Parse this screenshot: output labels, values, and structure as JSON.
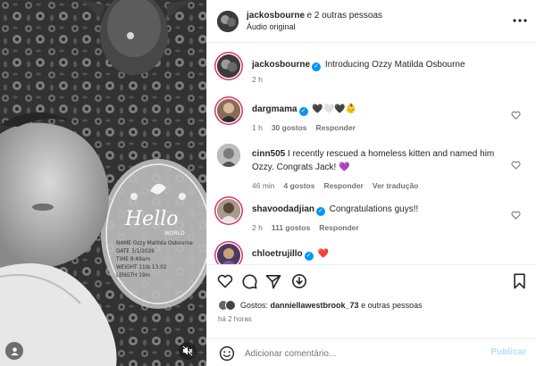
{
  "header": {
    "username": "jackosbourne",
    "others_text": "e 2 outras pessoas",
    "audio_label": "Áudio original"
  },
  "caption": {
    "username": "jackosbourne",
    "text": "Introducing Ozzy Matilda Osbourne",
    "time": "2 h"
  },
  "photo_card": {
    "hello": "Hello",
    "world": "WORLD",
    "lines": [
      "NAME Ozzy Matilda Osbourne",
      "DATE 3/1/2026",
      "TIME 8:49am",
      "WEIGHT 11lb 13.02",
      "LENGTH 19in"
    ]
  },
  "comments": [
    {
      "username": "dargmama",
      "verified": true,
      "text": "🖤🤍🖤👶",
      "time": "1 h",
      "likes": "30 gostos",
      "reply": "Responder",
      "translate": ""
    },
    {
      "username": "cinn505",
      "verified": false,
      "text": "I recently rescued a homeless kitten and named him Ozzy. Congrats Jack! 💜",
      "time": "46 min",
      "likes": "4 gostos",
      "reply": "Responder",
      "translate": "Ver tradução"
    },
    {
      "username": "shavoodadjian",
      "verified": true,
      "text": "Congratulations guys!!",
      "time": "2 h",
      "likes": "111 gostos",
      "reply": "Responder",
      "translate": ""
    },
    {
      "username": "chloetrujillo",
      "verified": true,
      "text": "❤️",
      "time": "",
      "likes": "",
      "reply": "",
      "translate": ""
    }
  ],
  "likes": {
    "prefix": "Gostos:",
    "username": "danniellawestbrook_73",
    "suffix": "e outras pessoas"
  },
  "posted_when": "há 2 horas",
  "add_comment": {
    "placeholder": "Adicionar comentário...",
    "publish_label": "Publicar"
  },
  "colors": {
    "verified": "#0095f6",
    "publish_disabled": "#b2dffc",
    "story_ring": "#e1306c",
    "secondary_text": "#737373"
  },
  "icons": {
    "more": "more-horizontal-icon",
    "heart": "heart-icon",
    "comment": "comment-icon",
    "share": "share-icon",
    "save": "bookmark-icon",
    "emoji": "emoji-icon",
    "mute": "muted-speaker-icon"
  }
}
